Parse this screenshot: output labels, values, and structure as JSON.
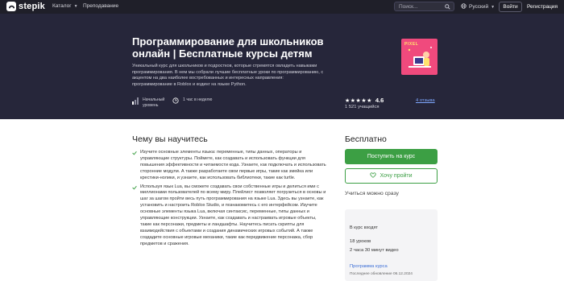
{
  "header": {
    "logo_text": "stepik",
    "nav": {
      "catalog": "Каталог",
      "teaching": "Преподавание"
    },
    "search": {
      "placeholder": "Поиск..."
    },
    "language": "Русский",
    "login": "Войти",
    "register": "Регистрация"
  },
  "course": {
    "title": "Программирование для школьников онлайн | Бесплатные курсы детям",
    "description": "Уникальный курс для школьников и подростков, которые стремятся овладеть навыками программирования. В нем мы собрали лучшие бесплатные уроки по программированию, с акцентом на два наиболее востребованных и интересных направления: программирование в Roblox и кодинг на языке Python.",
    "level": "Начальный уровень",
    "workload": "1 час в неделю",
    "cover_label": "PIXEL",
    "rating": "4.6",
    "stars_filled": 4.6,
    "learners": "1 521 учащийся",
    "reviews": "4 отзыва"
  },
  "learn": {
    "title": "Чему вы научитесь",
    "items": [
      "Изучите основные элементы языка: переменные, типы данных, операторы и управляющие структуры. Поймете, как создавать и использовать функции для повышения эффективности и читаемости кода. Узнаете, как подключать и использовать сторонние модули. А также разработаете свои первые игры, такие как змейка или крестики-нолики, и узнаете, как использовать библиотеки, такие как turtle.",
      "Используя язык Lua, вы сможете создавать свои собственные игры и делиться ими с миллионами пользователей по всему миру. Плейлист позволяет погрузиться в основы и шаг за шагом пройти весь путь программирования на языке Lua. Здесь вы узнаете, как установить и настроить Roblox Studio, и познакомитесь с его интерфейсом. Изучите основные элементы языка Lua, включая синтаксис, переменные, типы данных и управляющие конструкции. Узнаете, как создавать и настраивать игровые объекты, такие как персонажи, предметы и ландшафты. Научитесь писать скрипты для взаимодействия с объектами и создания динамических игровых событий. А также создадите основные игровые механики, такие как передвижение персонажа, сбор предметов и сражения."
    ]
  },
  "sidebar": {
    "price": "Бесплатно",
    "enroll": "Поступить на курс",
    "wishlist": "Хочу пройти",
    "study_free": "Учиться можно сразу",
    "includes_title": "В курс входят",
    "lessons": "18 уроков",
    "video": "2 часа 30 минут видео",
    "program": "Программа курса",
    "updated": "Последнее обновление 06.12.2024"
  },
  "colors": {
    "topbar": "#1f1f29",
    "hero": "#26263a",
    "accent_green": "#3c9f44",
    "link_blue": "#3d6fd6",
    "cover_pink": "#f04a7d"
  }
}
